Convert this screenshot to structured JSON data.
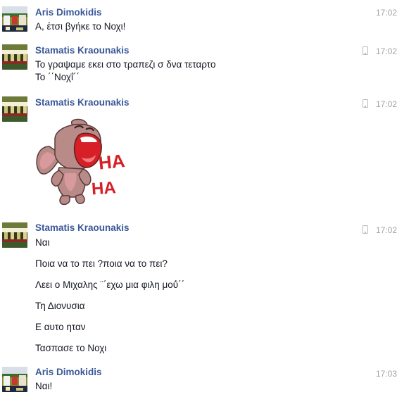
{
  "conversation": {
    "messages": [
      {
        "sender": "Aris Dimokidis",
        "time": "17:02",
        "mobile": false,
        "lines": [
          "Α, έτσι βγήκε το Νοχι!"
        ]
      },
      {
        "sender": "Stamatis Kraounakis",
        "time": "17:02",
        "mobile": true,
        "lines": [
          "Το γραψαμε εκει στο τραπεζι σ δνα τεταρτο",
          "Το ΄΄Νοχΐ΄΄"
        ]
      },
      {
        "sender": "Stamatis Kraounakis",
        "time": "17:02",
        "mobile": true,
        "sticker": {
          "icon": "laughing-bunny-sticker",
          "text_top": "HA",
          "text_bottom": "HA",
          "colors": {
            "body": "#b88a88",
            "ear_inner": "#d89a9c",
            "mouth": "#d61f26",
            "text": "#d61f26"
          }
        }
      },
      {
        "sender": "Stamatis Kraounakis",
        "time": "17:02",
        "mobile": true,
        "lines": [
          "Ναι",
          "Ποια να το πει ?ποια να το πει?",
          "Λεει ο Μιχαλης ¨΄εχω μια φιλη μοΰ΄΄",
          "Τη Διονυσια",
          "Ε αυτο ηταν",
          "Τασπασε το Νοχι"
        ]
      },
      {
        "sender": "Aris Dimokidis",
        "time": "17:03",
        "mobile": false,
        "lines": [
          "Ναι!"
        ]
      }
    ]
  },
  "colors": {
    "sender_name": "#3b5998",
    "timestamp": "#a0a4ab",
    "message_text": "#141823"
  }
}
